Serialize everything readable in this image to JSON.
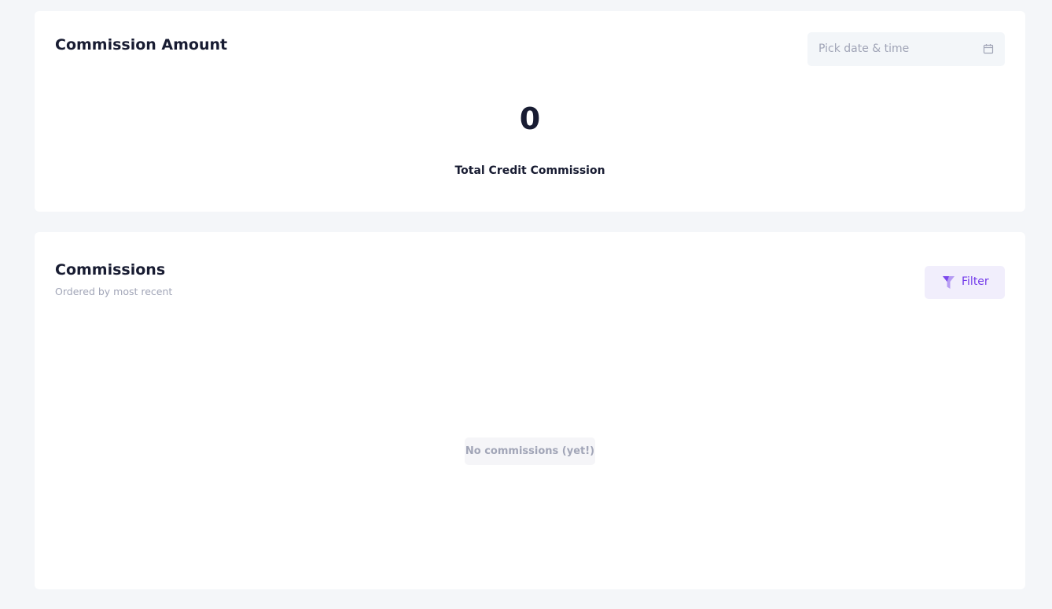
{
  "commission_amount": {
    "title": "Commission Amount",
    "date_picker": {
      "placeholder": "Pick date & time",
      "icon": "calendar-icon"
    },
    "total": {
      "value": "0",
      "label": "Total Credit Commission"
    }
  },
  "commissions": {
    "title": "Commissions",
    "subtitle": "Ordered by most recent",
    "filter_button": {
      "label": "Filter",
      "icon": "filter-icon"
    },
    "empty_message": "No commissions (yet!)"
  },
  "colors": {
    "page_background": "#f4f6f9",
    "card_background": "#ffffff",
    "heading": "#181c32",
    "muted": "#a1a5b7",
    "accent": "#7239ea",
    "accent_light": "#f1eefc"
  }
}
